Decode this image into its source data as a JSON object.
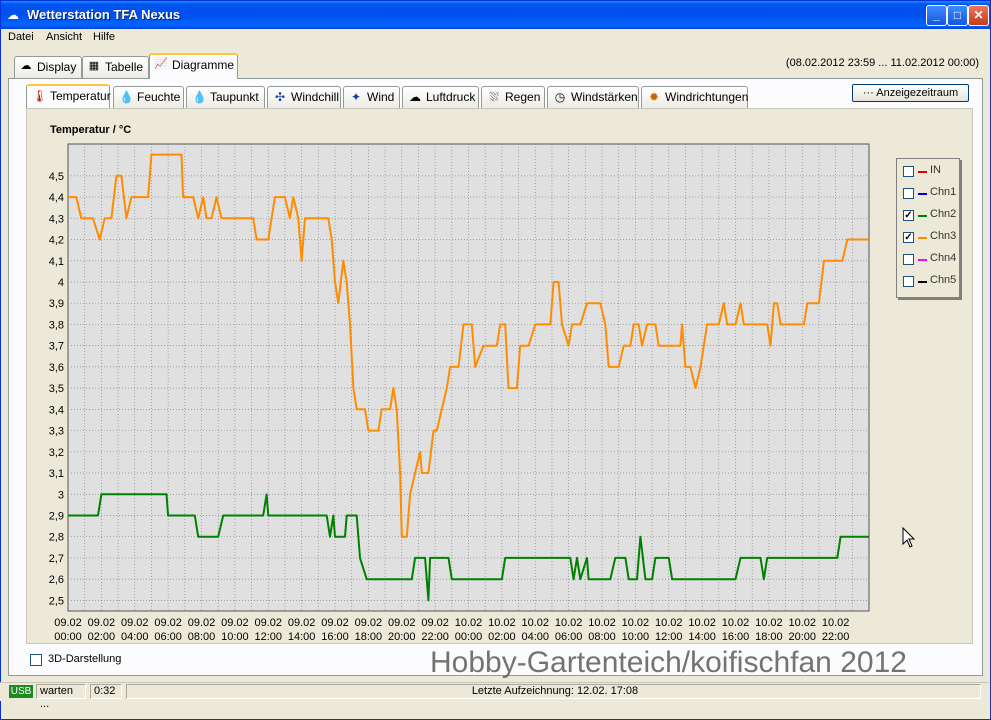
{
  "window": {
    "title": "Wetterstation TFA Nexus"
  },
  "menu": [
    "Datei",
    "Ansicht",
    "Hilfe"
  ],
  "main_tabs": [
    {
      "label": "Display",
      "icon": "display-icon"
    },
    {
      "label": "Tabelle",
      "icon": "table-icon"
    },
    {
      "label": "Diagramme",
      "icon": "chart-icon",
      "active": true
    }
  ],
  "time_range": "(08.02.2012 23:59 ... 11.02.2012 00:00)",
  "sub_tabs": [
    {
      "label": "Temperatur",
      "icon": "thermometer-icon",
      "active": true
    },
    {
      "label": "Feuchte",
      "icon": "humidity-icon"
    },
    {
      "label": "Taupunkt",
      "icon": "dewpoint-icon"
    },
    {
      "label": "Windchill",
      "icon": "windchill-icon"
    },
    {
      "label": "Wind",
      "icon": "wind-icon"
    },
    {
      "label": "Luftdruck",
      "icon": "pressure-icon"
    },
    {
      "label": "Regen",
      "icon": "rain-icon"
    },
    {
      "label": "Windstärken",
      "icon": "wind-strength-icon"
    },
    {
      "label": "Windrichtungen",
      "icon": "wind-direction-icon"
    }
  ],
  "range_button": "··· Anzeigezeitraum",
  "legend": [
    {
      "label": "IN",
      "color": "#e00000",
      "checked": false
    },
    {
      "label": "Chn1",
      "color": "#0000d0",
      "checked": false
    },
    {
      "label": "Chn2",
      "color": "#008000",
      "checked": true
    },
    {
      "label": "Chn3",
      "color": "#ff8c00",
      "checked": true
    },
    {
      "label": "Chn4",
      "color": "#ff00ff",
      "checked": false
    },
    {
      "label": "Chn5",
      "color": "#000000",
      "checked": false
    }
  ],
  "checkbox_3d": {
    "label": "3D-Darstellung",
    "checked": false
  },
  "watermark": "Hobby-Gartenteich/koifischfan 2012",
  "status": {
    "usb": "USB",
    "state": "warten ...",
    "time": "0:32",
    "last_record": "Letzte Aufzeichnung: 12.02. 17:08"
  },
  "chart_data": {
    "type": "line",
    "title": "Temperatur / °C",
    "ylim": [
      2.45,
      4.65
    ],
    "yticks": [
      "2,5",
      "2,6",
      "2,7",
      "2,8",
      "2,9",
      "3",
      "3,1",
      "3,2",
      "3,3",
      "3,4",
      "3,5",
      "3,6",
      "3,7",
      "3,8",
      "3,9",
      "4",
      "4,1",
      "4,2",
      "4,3",
      "4,4",
      "4,5"
    ],
    "xlim_hours": [
      0,
      48
    ],
    "xticks": [
      [
        "09.02",
        "00:00"
      ],
      [
        "09.02",
        "02:00"
      ],
      [
        "09.02",
        "04:00"
      ],
      [
        "09.02",
        "06:00"
      ],
      [
        "09.02",
        "08:00"
      ],
      [
        "09.02",
        "10:00"
      ],
      [
        "09.02",
        "12:00"
      ],
      [
        "09.02",
        "14:00"
      ],
      [
        "09.02",
        "16:00"
      ],
      [
        "09.02",
        "18:00"
      ],
      [
        "09.02",
        "20:00"
      ],
      [
        "09.02",
        "22:00"
      ],
      [
        "10.02",
        "00:00"
      ],
      [
        "10.02",
        "02:00"
      ],
      [
        "10.02",
        "04:00"
      ],
      [
        "10.02",
        "06:00"
      ],
      [
        "10.02",
        "08:00"
      ],
      [
        "10.02",
        "10:00"
      ],
      [
        "10.02",
        "12:00"
      ],
      [
        "10.02",
        "14:00"
      ],
      [
        "10.02",
        "16:00"
      ],
      [
        "10.02",
        "18:00"
      ],
      [
        "10.02",
        "20:00"
      ],
      [
        "10.02",
        "22:00"
      ]
    ],
    "grid": true,
    "series": [
      {
        "name": "Chn3",
        "color": "#ff8c00",
        "points": [
          [
            0,
            4.4
          ],
          [
            0.5,
            4.4
          ],
          [
            0.8,
            4.3
          ],
          [
            1.5,
            4.3
          ],
          [
            1.9,
            4.2
          ],
          [
            2.2,
            4.3
          ],
          [
            2.6,
            4.3
          ],
          [
            2.9,
            4.5
          ],
          [
            3.2,
            4.5
          ],
          [
            3.5,
            4.3
          ],
          [
            3.8,
            4.4
          ],
          [
            4.2,
            4.4
          ],
          [
            4.8,
            4.4
          ],
          [
            5.0,
            4.6
          ],
          [
            6.8,
            4.6
          ],
          [
            6.9,
            4.4
          ],
          [
            7.5,
            4.4
          ],
          [
            7.8,
            4.3
          ],
          [
            8.1,
            4.4
          ],
          [
            8.3,
            4.3
          ],
          [
            8.6,
            4.3
          ],
          [
            8.9,
            4.4
          ],
          [
            9.2,
            4.3
          ],
          [
            9.6,
            4.3
          ],
          [
            10.3,
            4.3
          ],
          [
            11.1,
            4.3
          ],
          [
            11.3,
            4.2
          ],
          [
            12.0,
            4.2
          ],
          [
            12.4,
            4.4
          ],
          [
            13.0,
            4.4
          ],
          [
            13.3,
            4.3
          ],
          [
            13.5,
            4.4
          ],
          [
            13.8,
            4.3
          ],
          [
            14.0,
            4.1
          ],
          [
            14.2,
            4.3
          ],
          [
            15.6,
            4.3
          ],
          [
            15.8,
            4.2
          ],
          [
            16.0,
            4.0
          ],
          [
            16.2,
            3.9
          ],
          [
            16.5,
            4.1
          ],
          [
            16.7,
            4.0
          ],
          [
            16.9,
            3.8
          ],
          [
            17.1,
            3.5
          ],
          [
            17.3,
            3.4
          ],
          [
            17.8,
            3.4
          ],
          [
            18.0,
            3.3
          ],
          [
            18.6,
            3.3
          ],
          [
            18.8,
            3.4
          ],
          [
            19.3,
            3.4
          ],
          [
            19.5,
            3.5
          ],
          [
            19.7,
            3.4
          ],
          [
            19.9,
            3.1
          ],
          [
            20.0,
            2.8
          ],
          [
            20.3,
            2.8
          ],
          [
            20.5,
            3.0
          ],
          [
            20.8,
            3.1
          ],
          [
            21.1,
            3.2
          ],
          [
            21.2,
            3.1
          ],
          [
            21.6,
            3.1
          ],
          [
            21.9,
            3.3
          ],
          [
            22.1,
            3.3
          ],
          [
            22.4,
            3.4
          ],
          [
            22.7,
            3.5
          ],
          [
            22.9,
            3.6
          ],
          [
            23.4,
            3.6
          ],
          [
            23.7,
            3.8
          ],
          [
            24.2,
            3.8
          ],
          [
            24.4,
            3.6
          ],
          [
            24.9,
            3.7
          ],
          [
            25.7,
            3.7
          ],
          [
            25.9,
            3.8
          ],
          [
            26.2,
            3.8
          ],
          [
            26.4,
            3.5
          ],
          [
            26.9,
            3.5
          ],
          [
            27.1,
            3.7
          ],
          [
            27.6,
            3.7
          ],
          [
            28.0,
            3.8
          ],
          [
            28.9,
            3.8
          ],
          [
            29.1,
            4.0
          ],
          [
            29.4,
            4.0
          ],
          [
            29.6,
            3.8
          ],
          [
            30.0,
            3.7
          ],
          [
            30.2,
            3.8
          ],
          [
            30.7,
            3.8
          ],
          [
            31.1,
            3.9
          ],
          [
            31.9,
            3.9
          ],
          [
            32.2,
            3.8
          ],
          [
            32.4,
            3.6
          ],
          [
            33.0,
            3.6
          ],
          [
            33.3,
            3.7
          ],
          [
            33.7,
            3.7
          ],
          [
            33.9,
            3.8
          ],
          [
            34.2,
            3.8
          ],
          [
            34.4,
            3.7
          ],
          [
            34.7,
            3.8
          ],
          [
            35.2,
            3.8
          ],
          [
            35.4,
            3.7
          ],
          [
            36.7,
            3.7
          ],
          [
            36.8,
            3.8
          ],
          [
            37.0,
            3.6
          ],
          [
            37.3,
            3.6
          ],
          [
            37.6,
            3.5
          ],
          [
            37.9,
            3.6
          ],
          [
            38.1,
            3.7
          ],
          [
            38.3,
            3.8
          ],
          [
            39.0,
            3.8
          ],
          [
            39.3,
            3.9
          ],
          [
            39.5,
            3.8
          ],
          [
            40.0,
            3.8
          ],
          [
            40.3,
            3.9
          ],
          [
            40.5,
            3.8
          ],
          [
            41.9,
            3.8
          ],
          [
            42.1,
            3.7
          ],
          [
            42.3,
            3.9
          ],
          [
            42.5,
            3.9
          ],
          [
            42.7,
            3.8
          ],
          [
            44.1,
            3.8
          ],
          [
            44.3,
            3.9
          ],
          [
            45.0,
            3.9
          ],
          [
            45.3,
            4.1
          ],
          [
            46.4,
            4.1
          ],
          [
            46.7,
            4.2
          ],
          [
            48,
            4.2
          ]
        ]
      },
      {
        "name": "Chn2",
        "color": "#008000",
        "points": [
          [
            0,
            2.9
          ],
          [
            1.8,
            2.9
          ],
          [
            2.0,
            3.0
          ],
          [
            5.9,
            3.0
          ],
          [
            6.0,
            2.9
          ],
          [
            7.6,
            2.9
          ],
          [
            7.8,
            2.8
          ],
          [
            9.0,
            2.8
          ],
          [
            9.3,
            2.9
          ],
          [
            11.7,
            2.9
          ],
          [
            11.9,
            3.0
          ],
          [
            12.0,
            2.9
          ],
          [
            15.5,
            2.9
          ],
          [
            15.7,
            2.8
          ],
          [
            15.9,
            2.9
          ],
          [
            16.0,
            2.8
          ],
          [
            16.6,
            2.8
          ],
          [
            16.7,
            2.9
          ],
          [
            17.3,
            2.9
          ],
          [
            17.5,
            2.7
          ],
          [
            17.9,
            2.6
          ],
          [
            20.6,
            2.6
          ],
          [
            20.8,
            2.7
          ],
          [
            21.4,
            2.7
          ],
          [
            21.6,
            2.5
          ],
          [
            21.7,
            2.7
          ],
          [
            22.8,
            2.7
          ],
          [
            23.0,
            2.6
          ],
          [
            26.0,
            2.6
          ],
          [
            26.2,
            2.7
          ],
          [
            30.1,
            2.7
          ],
          [
            30.3,
            2.6
          ],
          [
            30.5,
            2.7
          ],
          [
            30.7,
            2.6
          ],
          [
            31.1,
            2.7
          ],
          [
            31.2,
            2.6
          ],
          [
            32.5,
            2.6
          ],
          [
            32.8,
            2.7
          ],
          [
            33.4,
            2.7
          ],
          [
            33.6,
            2.6
          ],
          [
            34.1,
            2.6
          ],
          [
            34.3,
            2.8
          ],
          [
            34.6,
            2.6
          ],
          [
            35.0,
            2.6
          ],
          [
            35.2,
            2.7
          ],
          [
            36.0,
            2.7
          ],
          [
            36.2,
            2.6
          ],
          [
            40.0,
            2.6
          ],
          [
            40.3,
            2.7
          ],
          [
            41.5,
            2.7
          ],
          [
            41.7,
            2.6
          ],
          [
            41.9,
            2.7
          ],
          [
            46.1,
            2.7
          ],
          [
            46.3,
            2.8
          ],
          [
            48,
            2.8
          ]
        ]
      }
    ]
  }
}
